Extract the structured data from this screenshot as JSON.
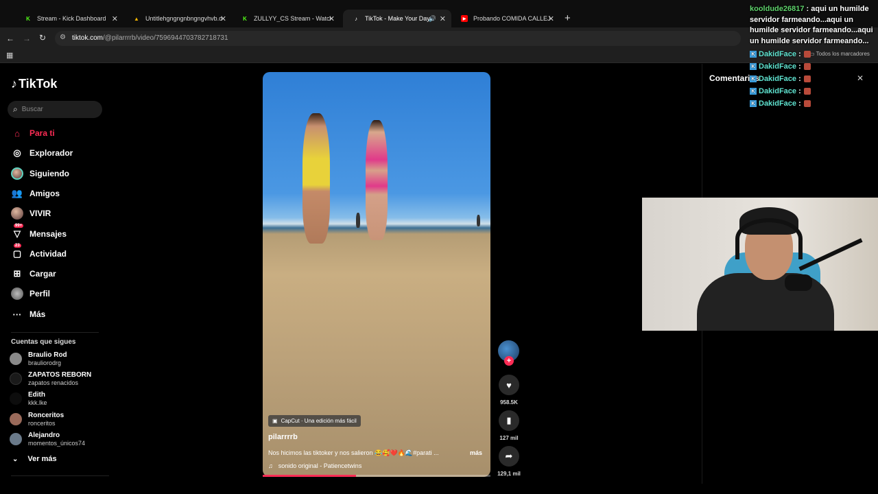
{
  "browser": {
    "tabs": [
      {
        "title": "Stream - Kick Dashboard",
        "favicon": "kick-icon",
        "color": "#53fc18"
      },
      {
        "title": "Untitlehgngngnbngngvhvb.d.jp",
        "favicon": "drive-icon",
        "color": "#f4b400"
      },
      {
        "title": "ZULLYY_CS Stream - Watch Live",
        "favicon": "kick-icon",
        "color": "#53fc18"
      },
      {
        "title": "TikTok - Make Your Day",
        "favicon": "tiktok-icon",
        "color": "#ffffff"
      },
      {
        "title": "Probando COMIDA CALLEJERA",
        "favicon": "youtube-icon",
        "color": "#ff0000"
      }
    ],
    "url_host": "tiktok.com",
    "url_path": "/@pilarrrrb/video/7596944703782718731",
    "bookmarks_label": "Todos los marcadores"
  },
  "tiktok": {
    "logo": "TikTok",
    "search_placeholder": "Buscar",
    "nav": [
      {
        "label": "Para ti",
        "icon": "home-icon",
        "active": true
      },
      {
        "label": "Explorador",
        "icon": "compass-icon"
      },
      {
        "label": "Siguiendo",
        "icon": "following-avatar-icon"
      },
      {
        "label": "Amigos",
        "icon": "friends-icon"
      },
      {
        "label": "VIVIR",
        "icon": "live-icon"
      },
      {
        "label": "Mensajes",
        "icon": "messages-icon",
        "badge": "99+"
      },
      {
        "label": "Actividad",
        "icon": "activity-icon",
        "badge": "23"
      },
      {
        "label": "Cargar",
        "icon": "upload-icon"
      },
      {
        "label": "Perfil",
        "icon": "profile-avatar-icon"
      },
      {
        "label": "Más",
        "icon": "more-dots-icon"
      }
    ],
    "following_title": "Cuentas que sigues",
    "following": [
      {
        "name": "Braulio Rod",
        "handle": "brauliorodrg",
        "color": "#8a8a8a"
      },
      {
        "name": "ZAPATOS REBORN",
        "handle": "zapatos renacidos",
        "color": "#1a1a1a"
      },
      {
        "name": "Edith",
        "handle": "kkk.lke",
        "color": "#0d0d0d"
      },
      {
        "name": "Ronceritos",
        "handle": "ronceritos",
        "color": "#9a6a5a"
      },
      {
        "name": "Alejandro",
        "handle": "momentos_únicos74",
        "color": "#6a7a8a"
      }
    ],
    "see_more": "Ver más",
    "video": {
      "capcut_tag": "CapCut · Una edición más fácil",
      "author": "pilarrrrb",
      "description": "Nos hicimos las tiktoker y nos salieron 😂🥰❤️🔥🌊#parati ...",
      "more_label": "más",
      "sound": "sonido original - Patiencetwins",
      "progress": 0.41
    },
    "actions": {
      "likes": "958.5K",
      "saves": "127 mil",
      "shares": "129,1 mil"
    },
    "comments_title": "Comentarios"
  },
  "stream_chat": {
    "top_messages": [
      {
        "user": "kooldude26817",
        "text": "aqui un humilde servidor farmeando...aqui un humilde servidor farmeando...aqui un humilde servidor farmeando..."
      }
    ],
    "lines": [
      {
        "user": "DakidFace",
        "sep": ":"
      },
      {
        "user": "DakidFace",
        "sep": ":"
      },
      {
        "user": "DakidFace",
        "sep": ":"
      },
      {
        "user": "DakidFace",
        "sep": ":"
      },
      {
        "user": "DakidFace",
        "sep": ":"
      }
    ]
  }
}
